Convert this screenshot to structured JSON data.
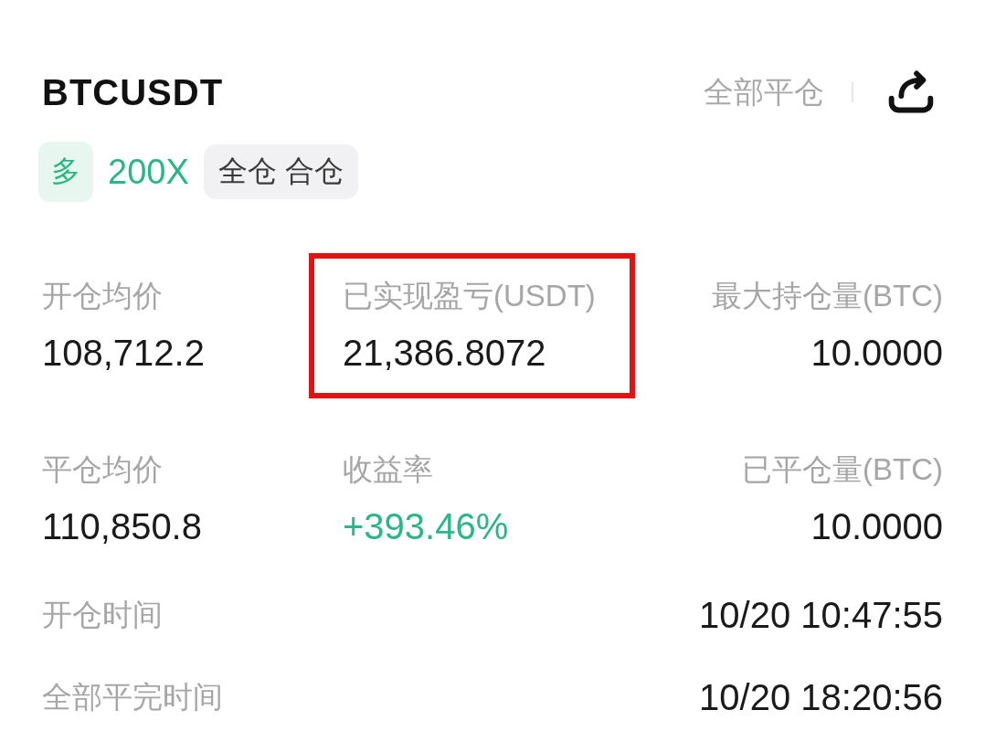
{
  "header": {
    "title": "BTCUSDT",
    "close_all": "全部平仓"
  },
  "tags": [
    {
      "kind": "side",
      "text": "多"
    },
    {
      "kind": "leverage",
      "text": "200X"
    },
    {
      "kind": "margin",
      "text": "全仓 合仓"
    }
  ],
  "stats": [
    {
      "label": "开仓均价",
      "value": "108,712.2",
      "positive": false,
      "highlighted": false
    },
    {
      "label": "已实现盈亏(USDT)",
      "value": "21,386.8072",
      "positive": false,
      "highlighted": true
    },
    {
      "label": "最大持仓量(BTC)",
      "value": "10.0000",
      "positive": false,
      "highlighted": false
    },
    {
      "label": "平仓均价",
      "value": "110,850.8",
      "positive": false,
      "highlighted": false
    },
    {
      "label": "收益率",
      "value": "+393.46%",
      "positive": true,
      "highlighted": false
    },
    {
      "label": "已平仓量(BTC)",
      "value": "10.0000",
      "positive": false,
      "highlighted": false
    }
  ],
  "times": [
    {
      "label": "开仓时间",
      "value": "10/20 10:47:55"
    },
    {
      "label": "全部平完时间",
      "value": "10/20 18:20:56"
    }
  ]
}
